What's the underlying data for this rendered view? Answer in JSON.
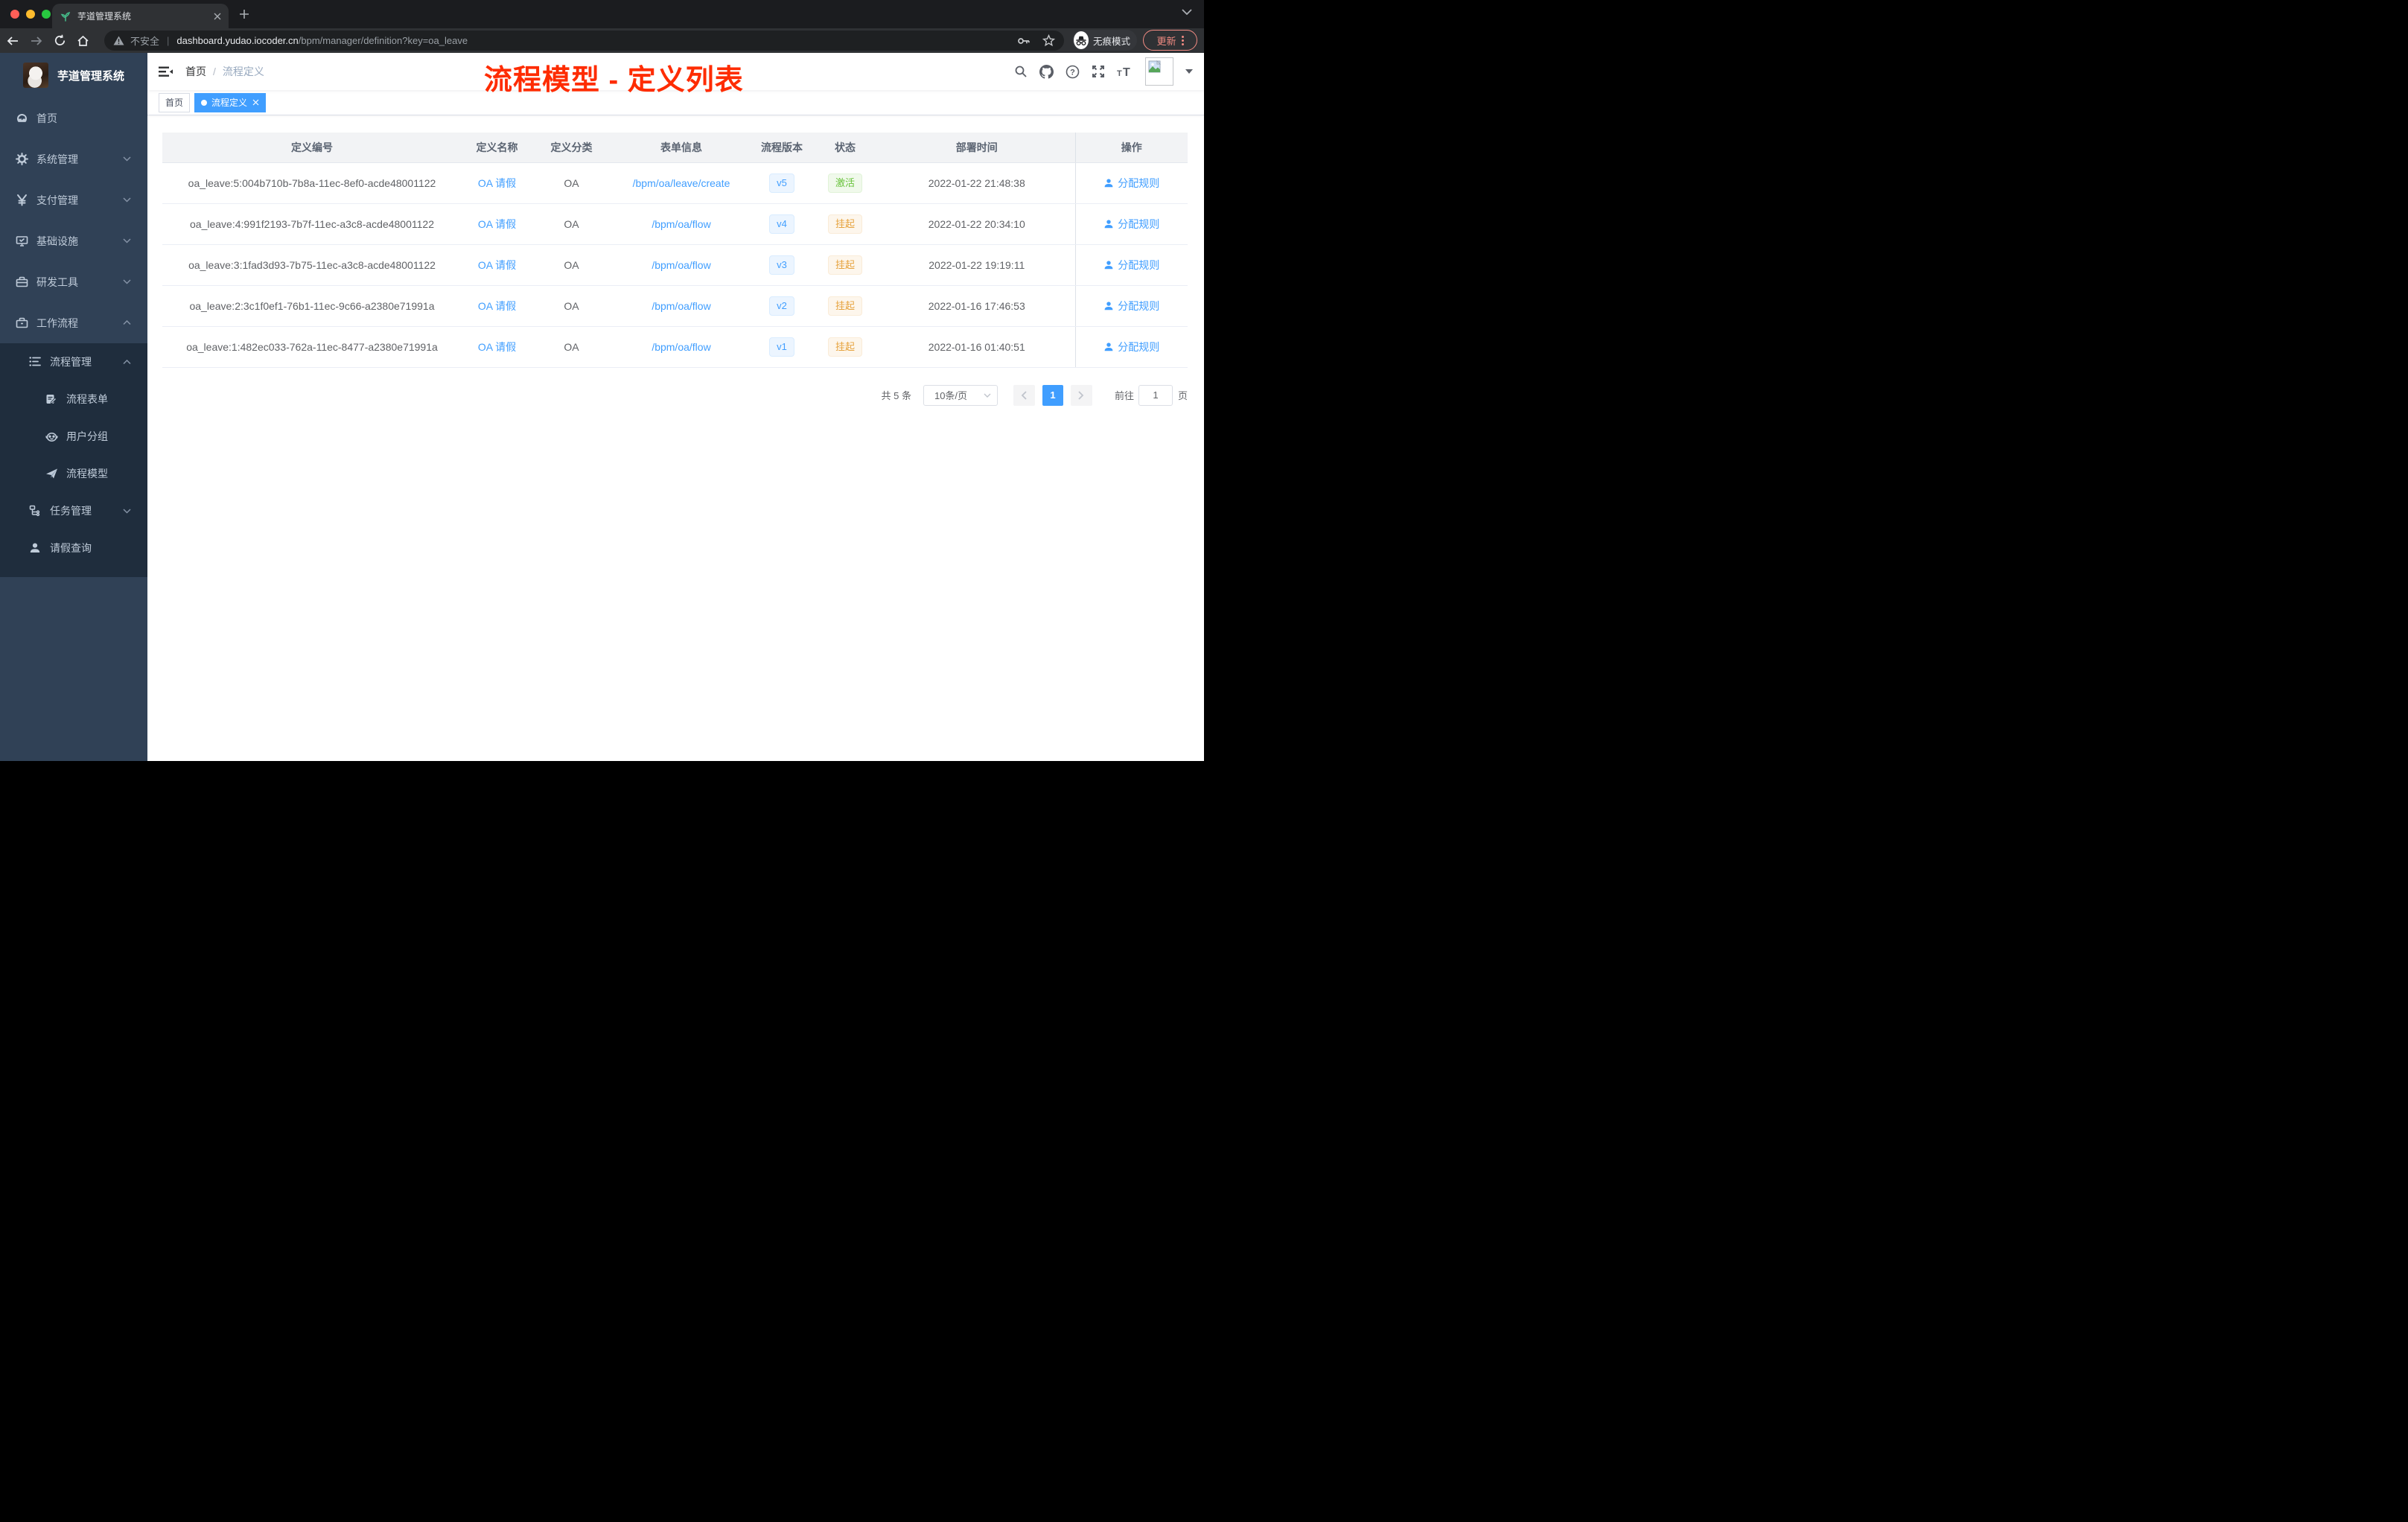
{
  "browser": {
    "tab_title": "芋道管理系统",
    "security_label": "不安全",
    "url_host": "dashboard.yudao.iocoder.cn",
    "url_path": "/bpm/manager/definition?key=oa_leave",
    "incognito_label": "无痕模式",
    "update_label": "更新"
  },
  "sidebar": {
    "title": "芋道管理系统",
    "items": [
      {
        "label": "首页",
        "icon": "dashboard-icon",
        "expandable": false
      },
      {
        "label": "系统管理",
        "icon": "gear-icon",
        "expandable": true
      },
      {
        "label": "支付管理",
        "icon": "yen-icon",
        "expandable": true
      },
      {
        "label": "基础设施",
        "icon": "monitor-icon",
        "expandable": true
      },
      {
        "label": "研发工具",
        "icon": "toolbox-icon",
        "expandable": true
      },
      {
        "label": "工作流程",
        "icon": "toolbox-icon",
        "expandable": true,
        "expanded": true
      }
    ],
    "workflow_menu": {
      "process_management": {
        "label": "流程管理",
        "icon": "list-icon",
        "expanded": true
      },
      "children": [
        {
          "label": "流程表单",
          "icon": "form-edit-icon"
        },
        {
          "label": "用户分组",
          "icon": "robot-icon"
        },
        {
          "label": "流程模型",
          "icon": "paper-plane-icon"
        }
      ],
      "task_management": {
        "label": "任务管理",
        "icon": "tree-icon",
        "expandable": true
      },
      "leave_query": {
        "label": "请假查询",
        "icon": "user-icon"
      }
    }
  },
  "navbar": {
    "breadcrumb": [
      "首页",
      "流程定义"
    ],
    "breadcrumb_separator": "/",
    "annotation": "流程模型 - 定义列表"
  },
  "tags": {
    "home": "首页",
    "active": "流程定义"
  },
  "table": {
    "columns": [
      "定义编号",
      "定义名称",
      "定义分类",
      "表单信息",
      "流程版本",
      "状态",
      "部署时间",
      "操作"
    ],
    "rows": [
      {
        "id": "oa_leave:5:004b710b-7b8a-11ec-8ef0-acde48001122",
        "name": "OA 请假",
        "category": "OA",
        "form": "/bpm/oa/leave/create",
        "version": "v5",
        "status": "激活",
        "status_type": "success",
        "deploy_time": "2022-01-22 21:48:38",
        "action": "分配规则"
      },
      {
        "id": "oa_leave:4:991f2193-7b7f-11ec-a3c8-acde48001122",
        "name": "OA 请假",
        "category": "OA",
        "form": "/bpm/oa/flow",
        "version": "v4",
        "status": "挂起",
        "status_type": "warning",
        "deploy_time": "2022-01-22 20:34:10",
        "action": "分配规则"
      },
      {
        "id": "oa_leave:3:1fad3d93-7b75-11ec-a3c8-acde48001122",
        "name": "OA 请假",
        "category": "OA",
        "form": "/bpm/oa/flow",
        "version": "v3",
        "status": "挂起",
        "status_type": "warning",
        "deploy_time": "2022-01-22 19:19:11",
        "action": "分配规则"
      },
      {
        "id": "oa_leave:2:3c1f0ef1-76b1-11ec-9c66-a2380e71991a",
        "name": "OA 请假",
        "category": "OA",
        "form": "/bpm/oa/flow",
        "version": "v2",
        "status": "挂起",
        "status_type": "warning",
        "deploy_time": "2022-01-16 17:46:53",
        "action": "分配规则"
      },
      {
        "id": "oa_leave:1:482ec033-762a-11ec-8477-a2380e71991a",
        "name": "OA 请假",
        "category": "OA",
        "form": "/bpm/oa/flow",
        "version": "v1",
        "status": "挂起",
        "status_type": "warning",
        "deploy_time": "2022-01-16 01:40:51",
        "action": "分配规则"
      }
    ]
  },
  "pagination": {
    "total": "共 5 条",
    "page_size": "10条/页",
    "current_page": "1",
    "goto_label": "前往",
    "goto_value": "1",
    "page_unit": "页"
  },
  "icons": {
    "search-icon": "magnifier shape",
    "github-icon": "octocat mark",
    "help-icon": "question in circle",
    "fullscreen-icon": "four outward arrows",
    "text-size-icon": "tT glyphs",
    "incognito-icon": "hat and glasses",
    "assign-user-icon": "person silhouette",
    "hamburger-icon": "three bars with triangle"
  },
  "colors": {
    "accent": "#409eff",
    "annotation_red": "#fe2c01",
    "sidebar_bg": "#304156",
    "submenu_bg": "#1f2d3d",
    "sidebar_text": "#bfcbd9",
    "status_active": "#67c23a",
    "status_suspended": "#e6a23c",
    "update_pill": "#f28b82"
  }
}
